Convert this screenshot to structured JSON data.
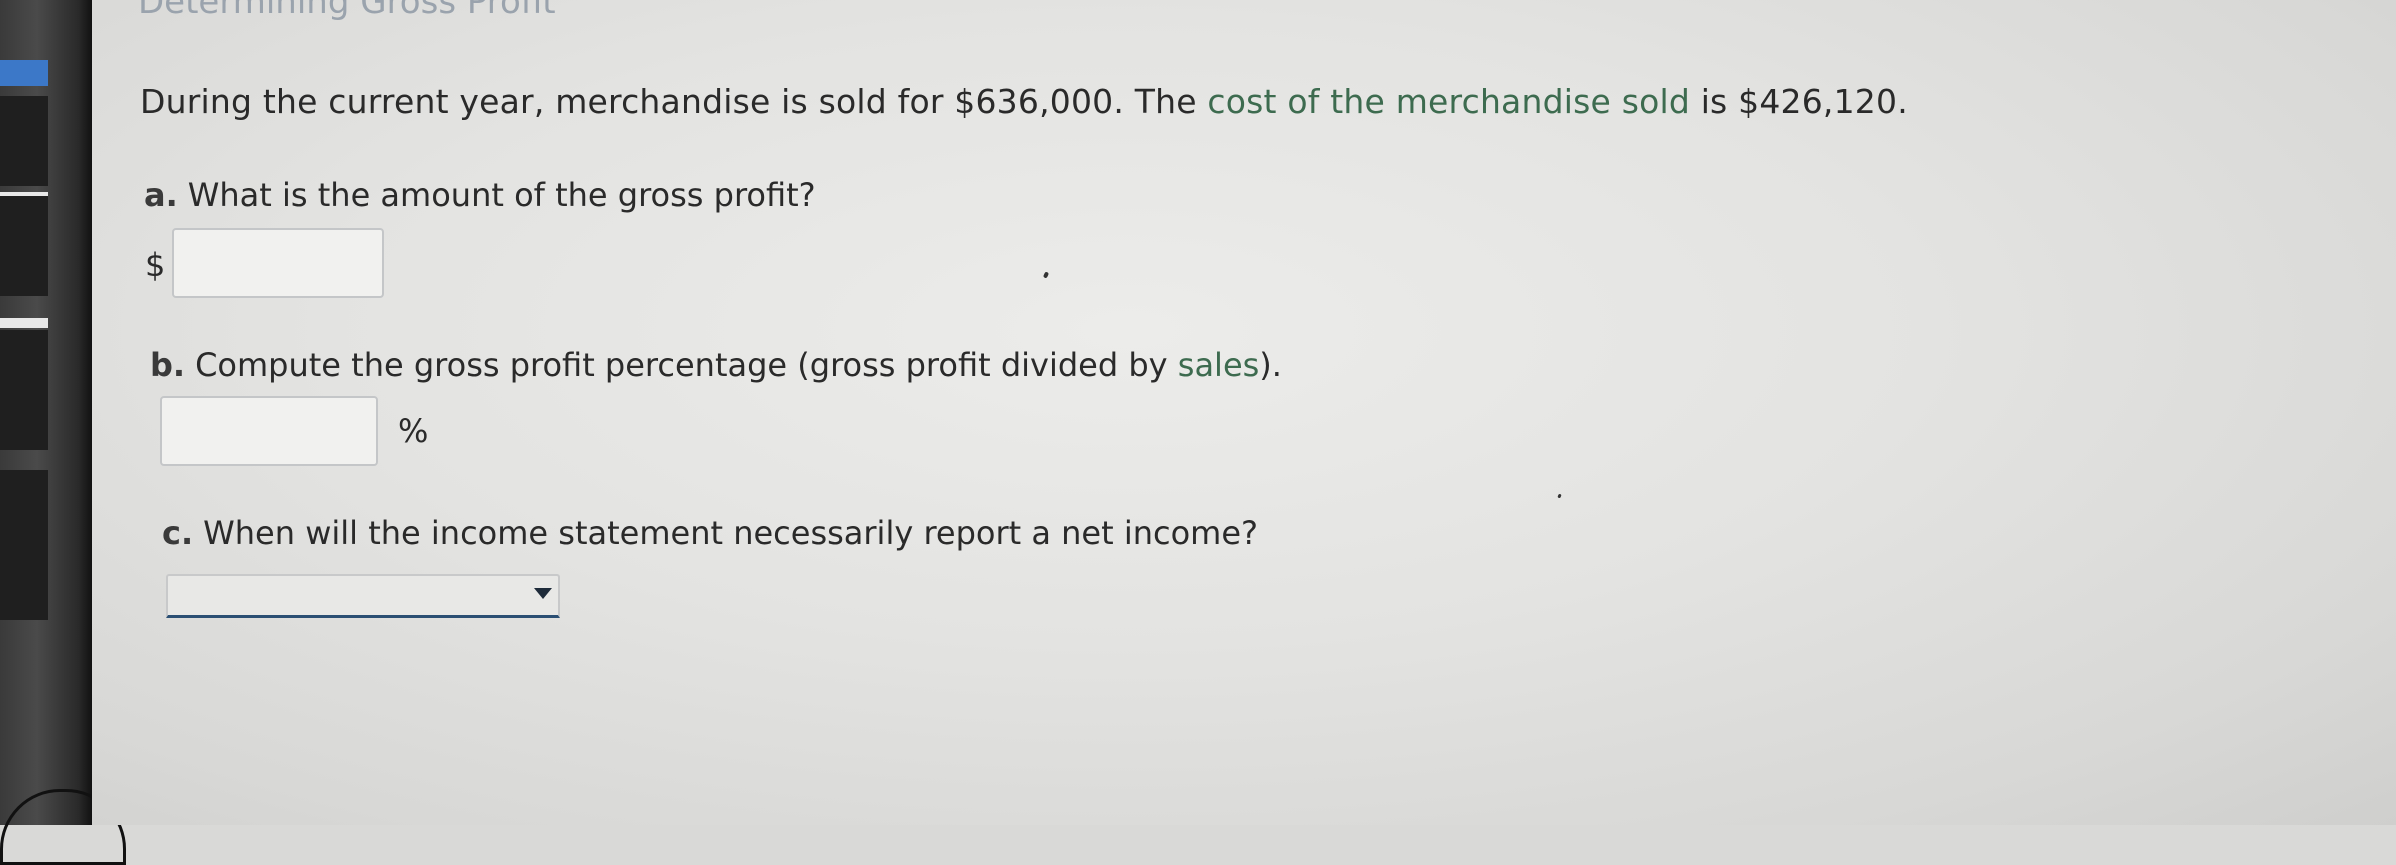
{
  "page": {
    "heading": "Determining Gross Profit"
  },
  "problem": {
    "intro": "During the current year, merchandise is sold for $636,000. The ",
    "term": "cost of the merchandise sold",
    "outro": " is $426,120."
  },
  "questions": {
    "a": {
      "letter": "a.",
      "text": "What is the amount of the gross profit?",
      "prefix": "$",
      "value": ""
    },
    "b": {
      "letter": "b.",
      "text_before": "Compute the gross profit percentage (gross profit divided by ",
      "term": "sales",
      "text_after": ").",
      "suffix": "%",
      "value": ""
    },
    "c": {
      "letter": "c.",
      "text": "When will the income statement necessarily report a net income?",
      "selected": ""
    }
  },
  "colors": {
    "glossary_term": "#3d6b4f",
    "select_underline": "#2b4f73",
    "sidebar_tab_accent": "#3c78c8"
  },
  "icons": {
    "dropdown": "caret-down-icon"
  }
}
